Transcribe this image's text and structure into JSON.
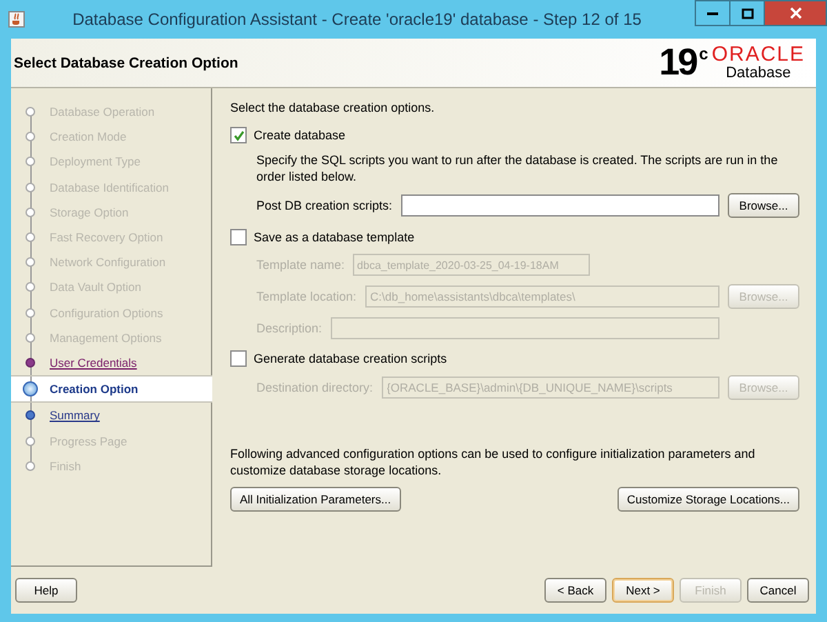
{
  "window": {
    "title": "Database Configuration Assistant - Create 'oracle19' database - Step 12 of 15"
  },
  "header": {
    "title": "Select Database Creation Option",
    "logo": {
      "version": "19",
      "version_suffix": "c",
      "brand": "ORACLE",
      "product": "Database"
    }
  },
  "steps": [
    {
      "label": "Database Operation",
      "selected": false,
      "disabled": true,
      "visited": false
    },
    {
      "label": "Creation Mode",
      "selected": false,
      "disabled": true,
      "visited": false
    },
    {
      "label": "Deployment Type",
      "selected": false,
      "disabled": true,
      "visited": false
    },
    {
      "label": "Database Identification",
      "selected": false,
      "disabled": true,
      "visited": false
    },
    {
      "label": "Storage Option",
      "selected": false,
      "disabled": true,
      "visited": false
    },
    {
      "label": "Fast Recovery Option",
      "selected": false,
      "disabled": true,
      "visited": false
    },
    {
      "label": "Network Configuration",
      "selected": false,
      "disabled": true,
      "visited": false
    },
    {
      "label": "Data Vault Option",
      "selected": false,
      "disabled": true,
      "visited": false
    },
    {
      "label": "Configuration Options",
      "selected": false,
      "disabled": true,
      "visited": false
    },
    {
      "label": "Management Options",
      "selected": false,
      "disabled": true,
      "visited": false
    },
    {
      "label": "User Credentials",
      "selected": false,
      "disabled": false,
      "visited": true
    },
    {
      "label": "Creation Option",
      "selected": true,
      "disabled": false,
      "visited": false
    },
    {
      "label": "Summary",
      "selected": false,
      "disabled": false,
      "visited": false
    },
    {
      "label": "Progress Page",
      "selected": false,
      "disabled": true,
      "visited": false
    },
    {
      "label": "Finish",
      "selected": false,
      "disabled": true,
      "visited": false
    }
  ],
  "intro": "Select the database creation options.",
  "options": [
    {
      "label": "Create database",
      "checked": true,
      "description": "Specify the SQL scripts you want to run after the database is created. The scripts are run in the order listed below.",
      "fields": [
        {
          "label": "Post DB creation scripts:",
          "disabled": false,
          "wide": true,
          "browse": "Browse..."
        }
      ]
    },
    {
      "label": "Save as a database template",
      "checked": false,
      "fields": [
        {
          "label": "Template name:",
          "value": "dbca_template_2020-03-25_04-19-18AM",
          "disabled": true,
          "wide": false
        },
        {
          "label": "Template location:",
          "value": "C:\\db_home\\assistants\\dbca\\templates\\",
          "disabled": true,
          "wide": true,
          "browse": "Browse..."
        },
        {
          "label": "Description:",
          "disabled": true,
          "wide": true
        }
      ]
    },
    {
      "label": "Generate database creation scripts",
      "checked": false,
      "fields": [
        {
          "label": "Destination directory:",
          "value": "{ORACLE_BASE}\\admin\\{DB_UNIQUE_NAME}\\scripts",
          "disabled": true,
          "wide": true,
          "browse": "Browse..."
        }
      ]
    }
  ],
  "advanced": {
    "text": "Following advanced configuration options can be used to configure initialization parameters and customize database storage locations.",
    "buttons": [
      "All Initialization Parameters...",
      "Customize Storage Locations..."
    ]
  },
  "footer": {
    "help": "Help",
    "nav": [
      {
        "label": "< Back",
        "disabled": false,
        "default": false
      },
      {
        "label": "Next >",
        "disabled": false,
        "default": true
      },
      {
        "label": "Finish",
        "disabled": true,
        "default": false
      },
      {
        "label": "Cancel",
        "disabled": false,
        "default": false
      }
    ]
  }
}
